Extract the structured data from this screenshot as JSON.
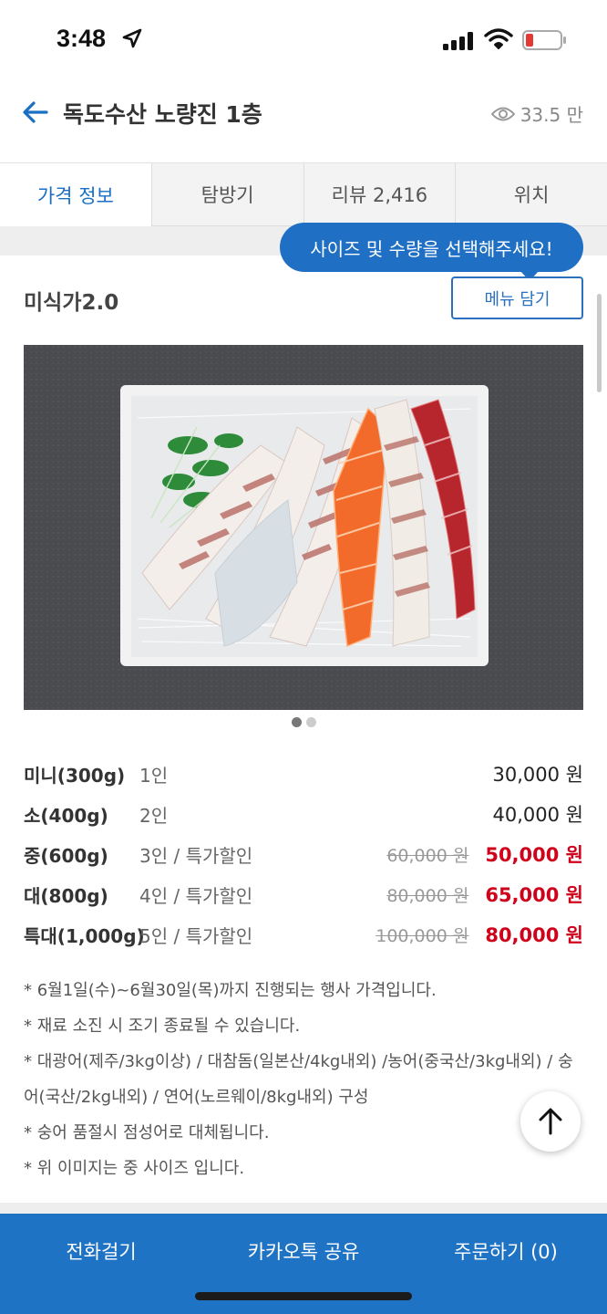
{
  "status_bar": {
    "time": "3:48"
  },
  "header": {
    "title": "독도수산 노량진 1층",
    "views": "33.5 만"
  },
  "tabs": [
    {
      "label": "가격 정보",
      "active": true
    },
    {
      "label": "탐방기",
      "active": false
    },
    {
      "label": "리뷰 2,416",
      "active": false
    },
    {
      "label": "위치",
      "active": false
    }
  ],
  "tooltip": "사이즈 및 수량을 선택해주세요!",
  "menu": {
    "name": "미식가2.0",
    "add_button": "메뉴 담기",
    "image_pages": 2,
    "image_current": 1
  },
  "prices": [
    {
      "size": "미니(300g)",
      "desc": "1인",
      "old": "",
      "price": "30,000 원",
      "sale": false
    },
    {
      "size": "소(400g)",
      "desc": "2인",
      "old": "",
      "price": "40,000 원",
      "sale": false
    },
    {
      "size": "중(600g)",
      "desc": "3인 / 특가할인",
      "old": "60,000 원",
      "price": "50,000 원",
      "sale": true
    },
    {
      "size": "대(800g)",
      "desc": "4인 / 특가할인",
      "old": "80,000 원",
      "price": "65,000 원",
      "sale": true
    },
    {
      "size": "특대(1,000g)",
      "desc": "5인 / 특가할인",
      "old": "100,000 원",
      "price": "80,000 원",
      "sale": true
    }
  ],
  "notes": [
    "* 6월1일(수)~6월30일(목)까지 진행되는 행사 가격입니다.",
    "* 재료 소진 시 조기 종료될 수 있습니다.",
    "* 대광어(제주/3kg이상) / 대참돔(일본산/4kg내외) /농어(중국산/3kg내외) / 숭어(국산/2kg내외) / 연어(노르웨이/8kg내외) 구성",
    "* 숭어 품절시 점성어로 대체됩니다.",
    "* 위 이미지는 중 사이즈 입니다."
  ],
  "bottom_bar": {
    "call": "전화걸기",
    "share": "카카오톡 공유",
    "order": "주문하기 (0)"
  },
  "colors": {
    "accent": "#1f73c4",
    "sale": "#d0021b"
  },
  "icons": [
    "back-arrow-icon",
    "eye-icon",
    "location-arrow-icon",
    "signal-icon",
    "wifi-icon",
    "battery-icon",
    "scroll-top-icon"
  ]
}
